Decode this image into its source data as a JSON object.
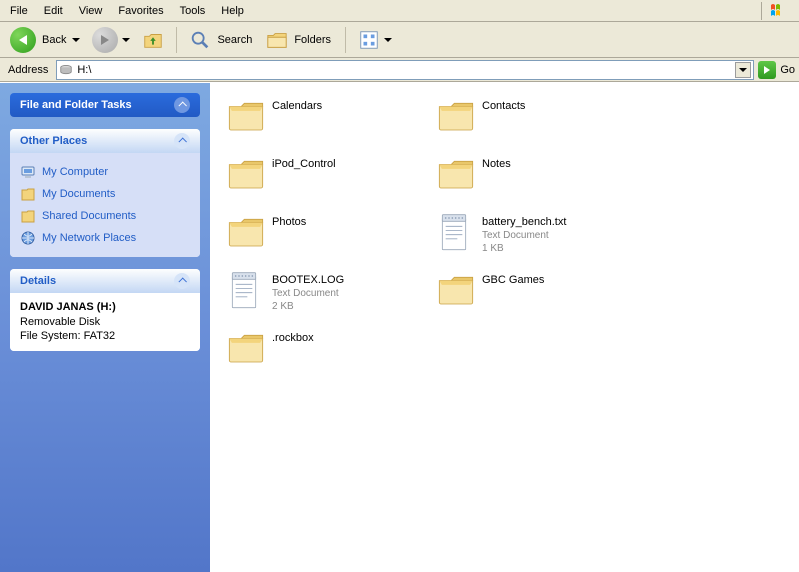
{
  "menu": {
    "items": [
      "File",
      "Edit",
      "View",
      "Favorites",
      "Tools",
      "Help"
    ]
  },
  "toolbar": {
    "back": "Back",
    "search": "Search",
    "folders": "Folders"
  },
  "address": {
    "label": "Address",
    "value": "H:\\",
    "go": "Go"
  },
  "tasks": {
    "ff_title": "File and Folder Tasks",
    "op_title": "Other Places",
    "op_items": [
      {
        "key": "mycomputer",
        "label": "My Computer"
      },
      {
        "key": "mydocs",
        "label": "My Documents"
      },
      {
        "key": "shared",
        "label": "Shared Documents"
      },
      {
        "key": "network",
        "label": "My Network Places"
      }
    ],
    "det_title": "Details",
    "det_name": "DAVID JANAS (H:)",
    "det_type": "Removable Disk",
    "det_fs": "File System: FAT32"
  },
  "files": [
    {
      "name": "Calendars",
      "type": "folder"
    },
    {
      "name": "Contacts",
      "type": "folder"
    },
    {
      "name": "iPod_Control",
      "type": "folder"
    },
    {
      "name": "Notes",
      "type": "folder"
    },
    {
      "name": "Photos",
      "type": "folder"
    },
    {
      "name": "battery_bench.txt",
      "type": "text",
      "sub1": "Text Document",
      "sub2": "1 KB"
    },
    {
      "name": "BOOTEX.LOG",
      "type": "text",
      "sub1": "Text Document",
      "sub2": "2 KB"
    },
    {
      "name": "GBC Games",
      "type": "folder"
    },
    {
      "name": ".rockbox",
      "type": "folder"
    }
  ]
}
